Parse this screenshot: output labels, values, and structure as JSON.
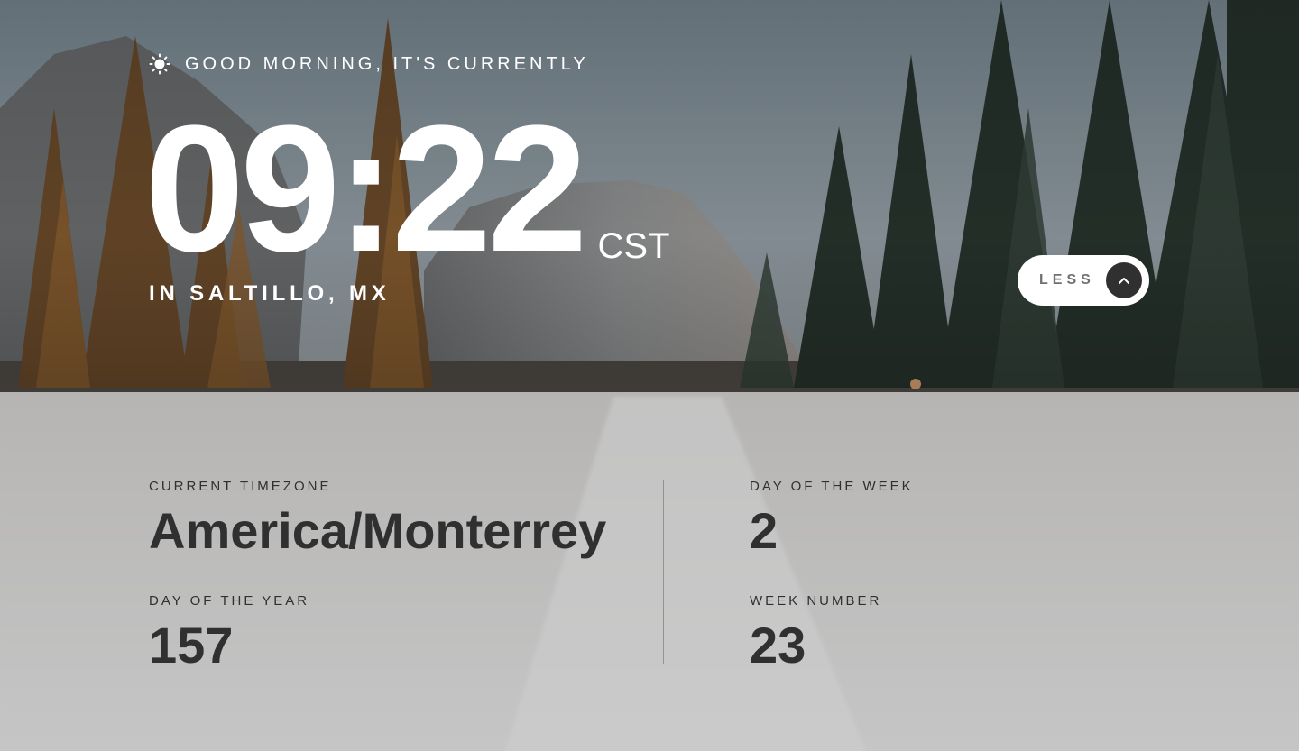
{
  "greeting": {
    "icon": "sun-icon",
    "text": "GOOD MORNING, IT'S CURRENTLY"
  },
  "clock": {
    "time": "09:22",
    "zone": "CST"
  },
  "location": "IN SALTILLO, MX",
  "toggle": {
    "label": "LESS",
    "icon": "chevron-up-icon"
  },
  "details": {
    "timezone": {
      "label": "CURRENT TIMEZONE",
      "value": "America/Monterrey"
    },
    "day_of_year": {
      "label": "DAY OF THE YEAR",
      "value": "157"
    },
    "day_of_week": {
      "label": "DAY OF THE WEEK",
      "value": "2"
    },
    "week_number": {
      "label": "WEEK NUMBER",
      "value": "23"
    }
  },
  "colors": {
    "text_light": "#ffffff",
    "text_dark": "#303030",
    "button_bg": "#ffffff",
    "button_label": "#707070",
    "arrow_bg": "#303030"
  }
}
